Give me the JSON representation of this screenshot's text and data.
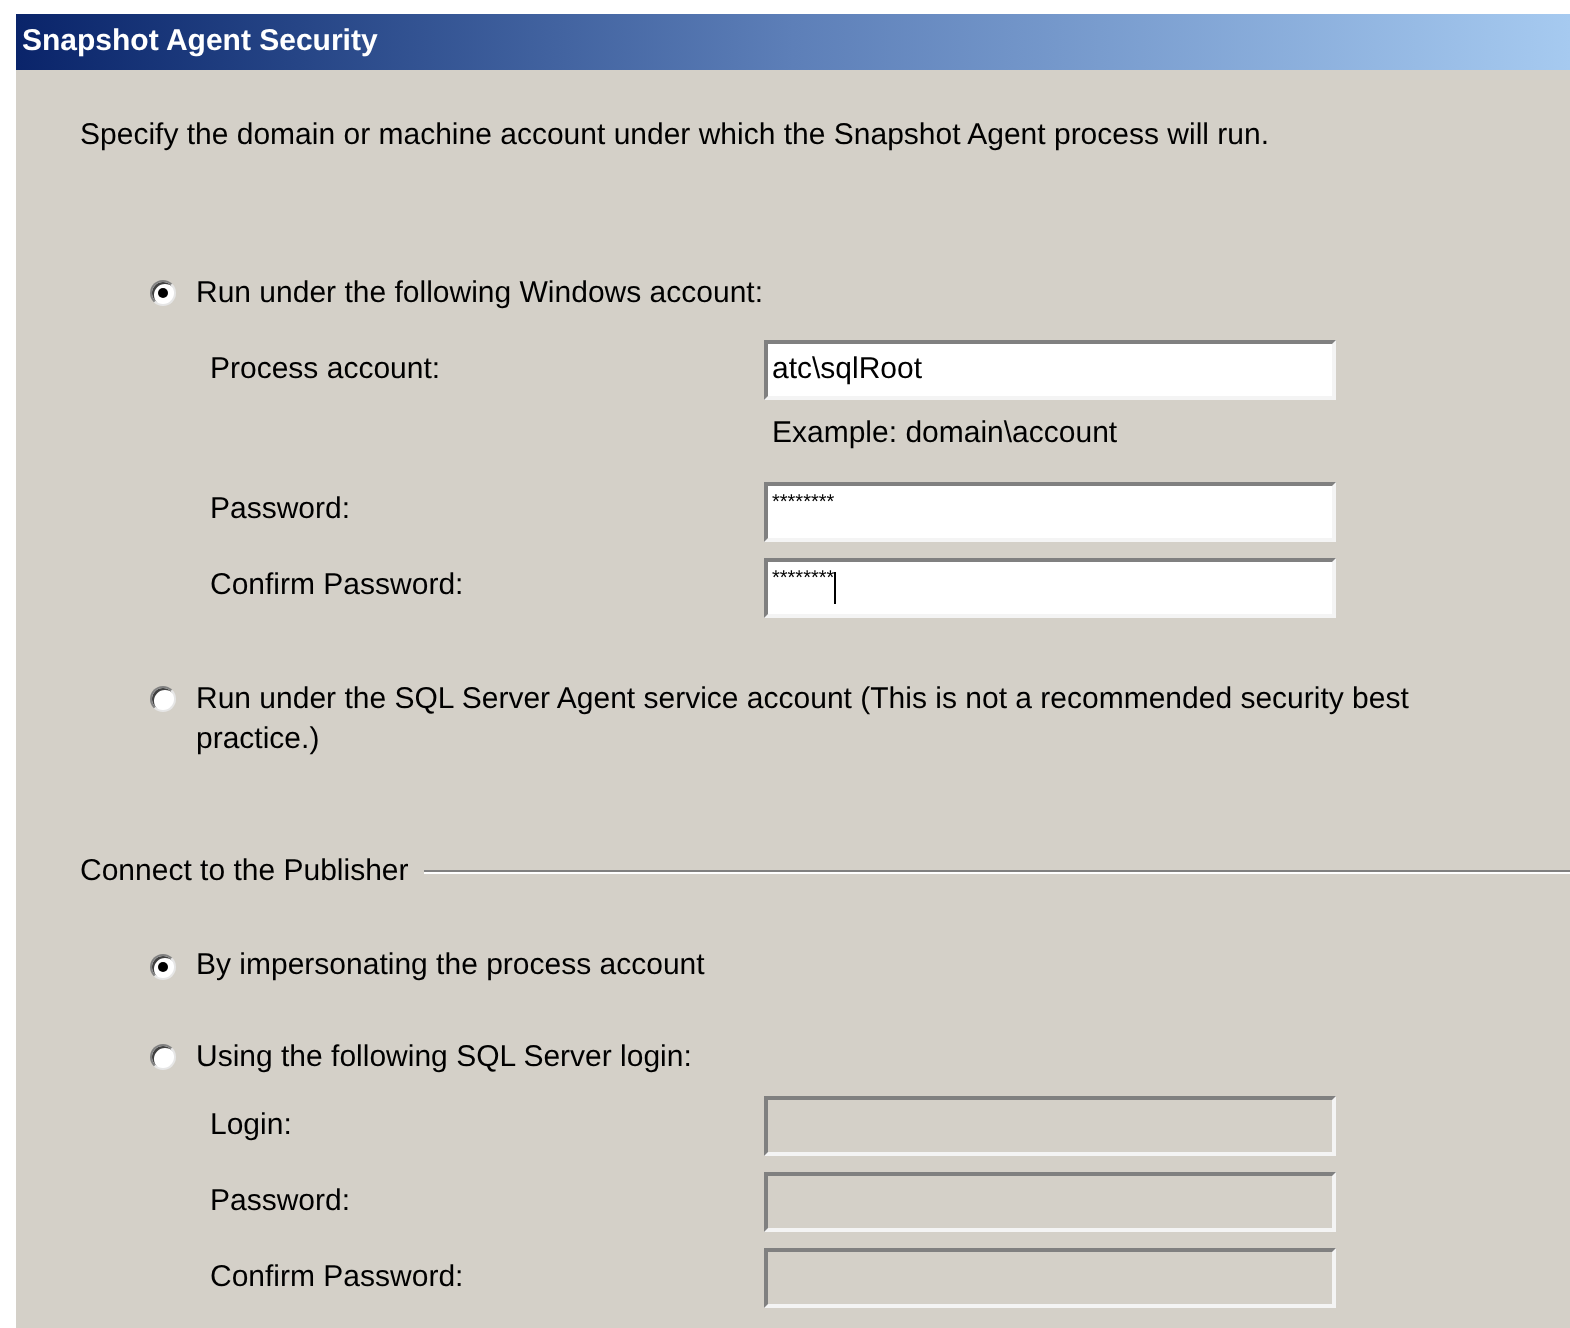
{
  "window": {
    "title": "Snapshot Agent Security"
  },
  "description": "Specify the domain or machine account under which the Snapshot Agent process will run.",
  "account_options": [
    {
      "label": "Run under the following Windows account:",
      "selected": true
    },
    {
      "label": "Run under the SQL Server Agent service account (This is not a recommended security best practice.)",
      "selected": false
    }
  ],
  "windows_account_fields": [
    {
      "label": "Process account:",
      "value": "atc\\sqlRoot",
      "hint": "Example: domain\\account",
      "disabled": false,
      "kind": "text",
      "focused": false
    },
    {
      "label": "Password:",
      "value": "********",
      "disabled": false,
      "kind": "password",
      "focused": false
    },
    {
      "label": "Confirm Password:",
      "value": "********",
      "disabled": false,
      "kind": "password",
      "focused": true
    }
  ],
  "publisher": {
    "title": "Connect to the Publisher",
    "options": [
      {
        "label": "By impersonating the process account",
        "selected": true
      },
      {
        "label": "Using the following SQL Server login:",
        "selected": false
      }
    ],
    "fields": [
      {
        "label": "Login:",
        "disabled": true
      },
      {
        "label": "Password:",
        "disabled": true
      },
      {
        "label": "Confirm Password:",
        "disabled": true
      }
    ]
  }
}
